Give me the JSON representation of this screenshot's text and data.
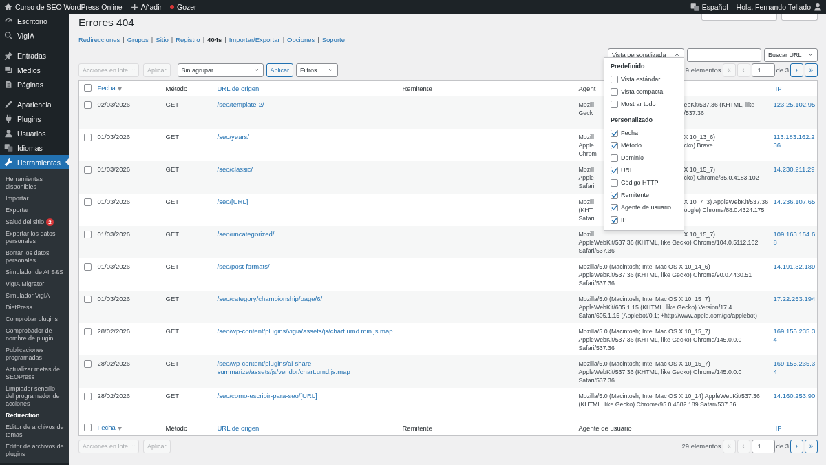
{
  "admin_bar": {
    "site": "Curso de SEO WordPress Online",
    "new": "Añadir",
    "plugin": {
      "label": "Gozer",
      "color": "#d63638"
    },
    "language": "Español",
    "greeting": "Hola, Fernando Tellado"
  },
  "sidebar": {
    "groups": [
      {
        "items": [
          {
            "label": "Escritorio",
            "selected": false
          },
          {
            "label": "VigIA",
            "selected": false
          }
        ]
      },
      {
        "items": [
          {
            "label": "Entradas",
            "selected": false
          },
          {
            "label": "Medios",
            "selected": false
          },
          {
            "label": "Páginas",
            "selected": false
          }
        ]
      },
      {
        "items": [
          {
            "label": "Apariencia",
            "selected": false
          },
          {
            "label": "Plugins",
            "selected": false
          },
          {
            "label": "Usuarios",
            "selected": false
          },
          {
            "label": "Idiomas",
            "selected": false
          },
          {
            "label": "Herramientas",
            "selected": true
          }
        ]
      }
    ],
    "submenu": [
      {
        "label": "Herramientas disponibles",
        "selected": false
      },
      {
        "label": "Importar",
        "selected": false
      },
      {
        "label": "Exportar",
        "selected": false
      },
      {
        "label": "Salud del sitio",
        "badge": "2",
        "selected": false
      },
      {
        "label": "Exportar los datos personales",
        "selected": false
      },
      {
        "label": "Borrar los datos personales",
        "selected": false
      },
      {
        "label": "Simulador de AI S&S",
        "selected": false
      },
      {
        "label": "VigIA Migrator",
        "selected": false
      },
      {
        "label": "Simulador VigIA",
        "selected": false
      },
      {
        "label": "DietPress",
        "selected": false
      },
      {
        "label": "Comprobar plugins",
        "selected": false
      },
      {
        "label": "Comprobador de nombre de plugin",
        "selected": false
      },
      {
        "label": "Publicaciones programadas",
        "selected": false
      },
      {
        "label": "Actualizar metas de SEOPress",
        "selected": false
      },
      {
        "label": "Limpiador sencillo del programador de acciones",
        "selected": false
      },
      {
        "label": "Redirection",
        "selected": true
      },
      {
        "label": "Editor de archivos de temas",
        "selected": false
      },
      {
        "label": "Editor de archivos de plugins",
        "selected": false
      }
    ]
  },
  "page": {
    "title": "Errores 404",
    "separator": "|",
    "subnav": [
      {
        "label": "Redirecciones",
        "selected": false
      },
      {
        "label": "Grupos",
        "selected": false
      },
      {
        "label": "Sitio",
        "selected": false
      },
      {
        "label": "Registro",
        "selected": false
      },
      {
        "label": "404s",
        "selected": true
      },
      {
        "label": "Importar/Exportar",
        "selected": false
      },
      {
        "label": "Opciones",
        "selected": false
      },
      {
        "label": "Soporte",
        "selected": false
      }
    ]
  },
  "toolbar": {
    "view": "Vista personalizada",
    "search_button": "Buscar URL",
    "bulk": {
      "label": "Acciones en lote",
      "disabled": true
    },
    "bulk_apply": {
      "label": "Aplicar",
      "disabled": true
    },
    "group": "Sin agrupar",
    "apply": "Aplicar",
    "filters": "Filtros",
    "count": "9 elementos",
    "page": "1",
    "of": "de 3",
    "pager": [
      {
        "label": "«",
        "disabled": true
      },
      {
        "label": "‹",
        "disabled": true
      },
      {
        "label": "›",
        "disabled": false
      },
      {
        "label": "»",
        "disabled": false
      }
    ]
  },
  "view_menu": {
    "sections": [
      {
        "heading": "Predefinido",
        "options": [
          {
            "label": "Vista estándar",
            "checked": false
          },
          {
            "label": "Vista compacta",
            "checked": false
          },
          {
            "label": "Mostrar todo",
            "checked": false
          }
        ]
      },
      {
        "heading": "Personalizado",
        "options": [
          {
            "label": "Fecha",
            "checked": true
          },
          {
            "label": "Método",
            "checked": true
          },
          {
            "label": "Dominio",
            "checked": false
          },
          {
            "label": "URL",
            "checked": true
          },
          {
            "label": "Código HTTP",
            "checked": false
          },
          {
            "label": "Remitente",
            "checked": true
          },
          {
            "label": "Agente de usuario",
            "checked": true
          },
          {
            "label": "IP",
            "checked": true
          }
        ]
      }
    ]
  },
  "table": {
    "select_all_checked": false,
    "header": [
      {
        "label": "Fecha",
        "link": true,
        "sorted": true
      },
      {
        "label": "Método",
        "link": false,
        "sorted": false
      },
      {
        "label": "URL de origen",
        "link": true,
        "sorted": false
      },
      {
        "label": "Remitente",
        "link": false,
        "sorted": false
      },
      {
        "label": "Agent",
        "link": false,
        "sorted": false
      },
      {
        "label": "IP",
        "link": true,
        "sorted": false
      }
    ],
    "footer": [
      {
        "label": "Fecha",
        "link": true,
        "sorted": true
      },
      {
        "label": "Método",
        "link": false,
        "sorted": false
      },
      {
        "label": "URL de origen",
        "link": true,
        "sorted": false
      },
      {
        "label": "Remitente",
        "link": false,
        "sorted": false
      },
      {
        "label": "Agente de usuario",
        "link": false,
        "sorted": false
      },
      {
        "label": "IP",
        "link": true,
        "sorted": false
      }
    ],
    "rows": [
      {
        "checked": false,
        "date": "02/03/2026",
        "method": "GET",
        "url": "/seo/template-2/",
        "agent": [
          [
            "Mozill",
            "ebKit/537.36 (KHTML, like"
          ],
          [
            "Geck",
            "/537.36"
          ]
        ],
        "ip": "123.25.102.95"
      },
      {
        "checked": false,
        "date": "01/03/2026",
        "method": "GET",
        "url": "/seo/years/",
        "agent": [
          [
            "Mozill",
            "X 10_13_6)"
          ],
          [
            "Apple",
            "cko) Brave"
          ],
          [
            "Chrom"
          ]
        ],
        "ip": "113.183.162.236"
      },
      {
        "checked": false,
        "date": "01/03/2026",
        "method": "GET",
        "url": "/seo/classic/",
        "agent": [
          [
            "Mozill",
            "X 10_15_7)"
          ],
          [
            "Apple",
            "cko) Chrome/85.0.4183.102"
          ],
          [
            "Safari"
          ]
        ],
        "ip": "14.230.211.29"
      },
      {
        "checked": false,
        "date": "01/03/2026",
        "method": "GET",
        "url": "/seo/[URL]",
        "agent": [
          [
            "Mozill",
            "X 10_7_3) AppleWebKit/537.36"
          ],
          [
            "(KHT",
            "oogle) Chrome/88.0.4324.175"
          ],
          [
            "Safari"
          ]
        ],
        "ip": "14.236.107.65"
      },
      {
        "checked": false,
        "date": "01/03/2026",
        "method": "GET",
        "url": "/seo/uncategorized/",
        "agent": [
          [
            "Mozill",
            "X 10_15_7)"
          ],
          [
            "AppleWebKit/537.36 (KHTML, like Gecko) Chrome/104.0.5112.102"
          ],
          [
            "Safari/537.36"
          ]
        ],
        "ip": "109.163.154.68"
      },
      {
        "checked": false,
        "date": "01/03/2026",
        "method": "GET",
        "url": "/seo/post-formats/",
        "agent": [
          [
            "Mozilla/5.0 (Macintosh; Intel Mac OS X 10_14_6)"
          ],
          [
            "AppleWebKit/537.36 (KHTML, like Gecko) Chrome/90.0.4430.51"
          ],
          [
            "Safari/537.36"
          ]
        ],
        "ip": "14.191.32.189"
      },
      {
        "checked": false,
        "date": "01/03/2026",
        "method": "GET",
        "url": "/seo/category/championship/page/6/",
        "agent": [
          [
            "Mozilla/5.0 (Macintosh; Intel Mac OS X 10_15_7)"
          ],
          [
            "AppleWebKit/605.1.15 (KHTML, like Gecko) Version/17.4"
          ],
          [
            "Safari/605.1.15 (Applebot/0.1; +http://www.apple.com/go/applebot)"
          ]
        ],
        "ip": "17.22.253.194"
      },
      {
        "checked": false,
        "date": "28/02/2026",
        "method": "GET",
        "url": "/seo/wp-content/plugins/vigia/assets/js/chart.umd.min.js.map",
        "agent": [
          [
            "Mozilla/5.0 (Macintosh; Intel Mac OS X 10_15_7)"
          ],
          [
            "AppleWebKit/537.36 (KHTML, like Gecko) Chrome/145.0.0.0"
          ],
          [
            "Safari/537.36"
          ]
        ],
        "ip": "169.155.235.34"
      },
      {
        "checked": false,
        "date": "28/02/2026",
        "method": "GET",
        "url": "/seo/wp-content/plugins/ai-share-summarize/assets/js/vendor/chart.umd.js.map",
        "agent": [
          [
            "Mozilla/5.0 (Macintosh; Intel Mac OS X 10_15_7)"
          ],
          [
            "AppleWebKit/537.36 (KHTML, like Gecko) Chrome/145.0.0.0"
          ],
          [
            "Safari/537.36"
          ]
        ],
        "ip": "169.155.235.34"
      },
      {
        "checked": false,
        "date": "28/02/2026",
        "method": "GET",
        "url": "/seo/como-escribir-para-seo/[URL]",
        "agent": [
          [
            "Mozilla/5.0 (Macintosh; Intel Mac OS X 10_14) AppleWebKit/537.36"
          ],
          [
            "(KHTML, like Gecko) Chrome/95.0.4582.189 Safari/537.36"
          ]
        ],
        "ip": "14.160.253.90"
      }
    ]
  },
  "bottom_toolbar": {
    "bulk": {
      "label": "Acciones en lote",
      "disabled": true
    },
    "bulk_apply": {
      "label": "Aplicar",
      "disabled": true
    },
    "count": "29 elementos",
    "page": "1",
    "of": "de 3",
    "pager": [
      {
        "label": "«",
        "disabled": true
      },
      {
        "label": "‹",
        "disabled": true
      },
      {
        "label": "›",
        "disabled": false
      },
      {
        "label": "»",
        "disabled": false
      }
    ]
  }
}
